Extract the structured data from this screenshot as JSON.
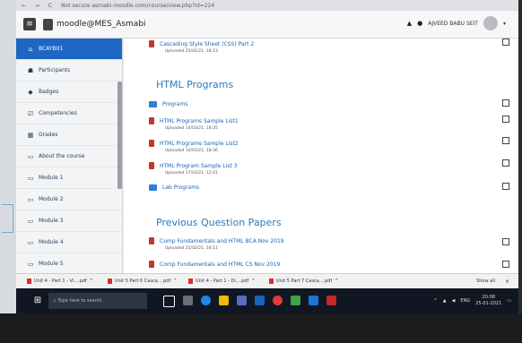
{
  "browser": {
    "nav": "← → C",
    "url_prefix": "Not secure",
    "url": "asmabi-moodle.com/course/view.php?id=224"
  },
  "header": {
    "menu_icon": "hamburger-icon",
    "site_name": "moodle@MES_Asmabi",
    "user_name": "AJVEED BABU SEIT"
  },
  "sidebar": {
    "items": [
      {
        "label": "BCAYB01",
        "icon": "course-icon"
      },
      {
        "label": "Participants",
        "icon": "users-icon"
      },
      {
        "label": "Badges",
        "icon": "badge-icon"
      },
      {
        "label": "Competencies",
        "icon": "check-icon"
      },
      {
        "label": "Grades",
        "icon": "grades-icon"
      },
      {
        "label": "About the course",
        "icon": "folder-icon"
      },
      {
        "label": "Module 1",
        "icon": "folder-icon"
      },
      {
        "label": "Module 2",
        "icon": "folder-icon"
      },
      {
        "label": "Module 3",
        "icon": "folder-icon"
      },
      {
        "label": "Module 4",
        "icon": "folder-icon"
      },
      {
        "label": "Module 5",
        "icon": "folder-icon"
      }
    ]
  },
  "main": {
    "top_file": {
      "name": "Cascading Style Sheet (CSS) Part 2",
      "meta": "Uploaded 25/02/21, 18:13"
    },
    "section1_title": "HTML Programs",
    "section1_items": [
      {
        "type": "folder",
        "name": "Programs",
        "meta": ""
      },
      {
        "type": "file",
        "name": "HTML Programs Sample List1",
        "meta": "Uploaded 14/03/21, 18:35"
      },
      {
        "type": "file",
        "name": "HTML Programs Sample List2",
        "meta": "Uploaded 14/03/21, 18:36"
      },
      {
        "type": "file",
        "name": "HTML Program Sample List 3",
        "meta": "Uploaded 17/03/21, 12:41"
      },
      {
        "type": "folder",
        "name": "Lab Programs",
        "meta": ""
      }
    ],
    "section2_title": "Previous Question Papers",
    "section2_items": [
      {
        "type": "file",
        "name": "Comp Fundamentals and HTML BCA Nov 2019",
        "meta": "Uploaded 25/02/21, 18:11"
      },
      {
        "type": "file",
        "name": "Comp Fundamentals and HTML CS Nov 2019",
        "meta": ""
      }
    ]
  },
  "downloads": {
    "items": [
      "Unit 4 - Part 1 - Vi....pdf",
      "Unit 5 Part 6 Casca....pdf",
      "Unit 4 - Part 1 - Di....pdf",
      "Unit 5 Part 7 Casca....pdf"
    ],
    "show_all": "Show all",
    "close": "×"
  },
  "taskbar": {
    "search_placeholder": "Type here to search",
    "time": "20:08",
    "date": "25-01-2021",
    "lang": "ENG"
  },
  "colors": {
    "accent": "#1f67c4",
    "link": "#1a63b3",
    "section_title": "#2d7ab8",
    "pdf_icon": "#c0392b"
  }
}
